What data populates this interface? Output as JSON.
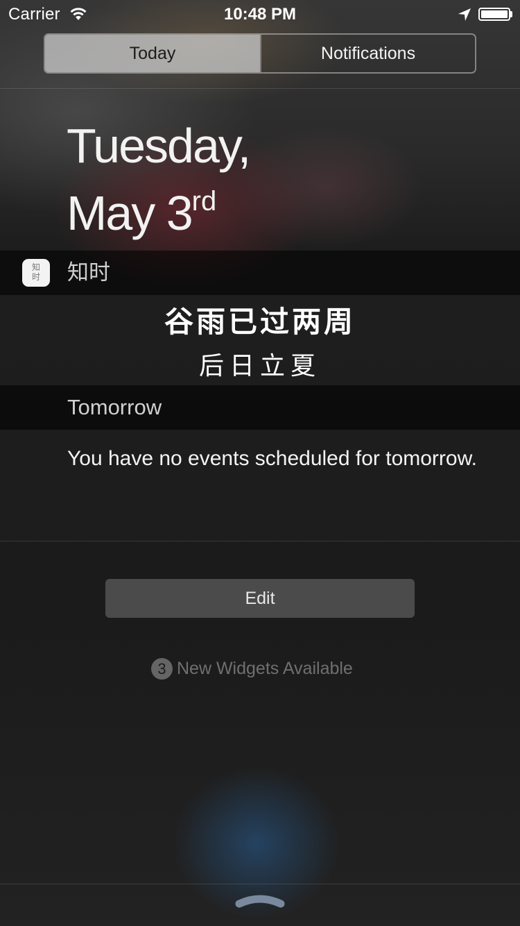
{
  "status_bar": {
    "carrier": "Carrier",
    "time": "10:48 PM",
    "icons": [
      "wifi-icon",
      "location-arrow-icon",
      "battery-icon"
    ]
  },
  "segmented_control": {
    "tabs": [
      {
        "label": "Today",
        "selected": true
      },
      {
        "label": "Notifications",
        "selected": false
      }
    ]
  },
  "date_header": {
    "line1": "Tuesday,",
    "line2": "May 3",
    "ordinal": "rd"
  },
  "widgets": [
    {
      "app_name": "知时",
      "icon_glyphs": [
        "知",
        "时"
      ],
      "lines": [
        "谷雨已过两周",
        "后日立夏"
      ]
    },
    {
      "title": "Tomorrow",
      "message": "You have no events scheduled for tomorrow."
    }
  ],
  "edit_button": {
    "label": "Edit"
  },
  "new_widgets": {
    "count": "3",
    "label": "New Widgets Available"
  },
  "colors": {
    "segment_selected_bg": "#d2d2d2",
    "edit_button_bg": "#4b4b4b",
    "muted_text": "#6f6f6f",
    "glow": "#285f96"
  }
}
